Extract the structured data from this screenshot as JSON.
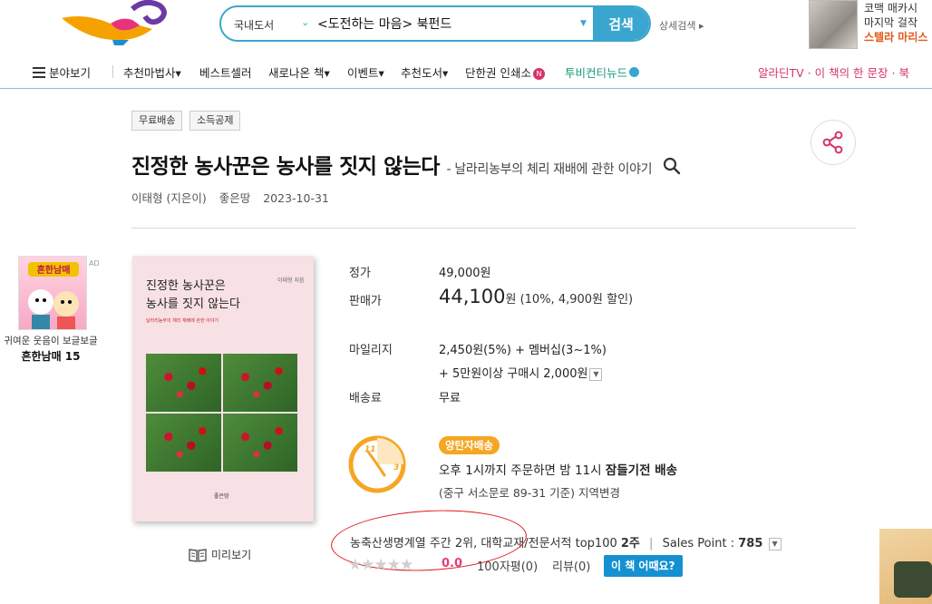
{
  "header": {
    "search": {
      "scope": "국내도서",
      "query": "<도전하는 마음> 북펀드",
      "button_label": "검색",
      "advanced_label": "상세검색 ▸"
    },
    "top_ad": {
      "line1": "코맥 매카시",
      "line2": "마지막 걸작",
      "line3": "스텔라 마리스"
    },
    "nav": {
      "category_label": "분야보기",
      "items": [
        "추천마법사▾",
        "베스트셀러",
        "새로나온 책▾",
        "이벤트▾",
        "추천도서▾",
        "단한권 인쇄소",
        "투비컨티뉴드"
      ],
      "right_label": "알라딘TV · 이 책의 한 문장 · 북"
    }
  },
  "book": {
    "tags": [
      "무료배송",
      "소득공제"
    ],
    "title": "진정한 농사꾼은 농사를 짓지 않는다",
    "subtitle": "- 날라리농부의 체리 재배에 관한 이야기",
    "author": "이태형 (지은이)",
    "publisher": "좋은땅",
    "date": "2023-10-31",
    "cover": {
      "title_line1": "진정한 농사꾼은",
      "title_line2": "농사를 짓지 않는다",
      "author": "이태형 지음",
      "subtitle": "날라리농부의 체리 재배에 관한 이야기",
      "publisher": "좋은땅"
    },
    "preview_label": "미리보기"
  },
  "price": {
    "list_label": "정가",
    "list_value": "49,000원",
    "sale_label": "판매가",
    "sale_value": "44,100",
    "sale_unit": "원",
    "sale_extra": "(10%, 4,900원 할인)",
    "mileage_label": "마일리지",
    "mileage_value": "2,450원(5%) + 멤버십(3~1%)",
    "mileage_extra": "+ 5만원이상 구매시 2,000원",
    "shipping_label": "배송료",
    "shipping_value": "무료"
  },
  "delivery": {
    "badge": "양탄자배송",
    "line1_prefix": "오후 1시까지 주문하면 밤 11시 ",
    "line1_bold": "잠들기전 배송",
    "line2": "(중구 서소문로 89-31 기준) 지역변경",
    "clock_num_11": "11",
    "clock_num_3": "3"
  },
  "ranking": {
    "cat1": "농축산생명계열 주간 2위,",
    "cat2": "대학교재/전문서적 top100",
    "cat2_bold": "2주",
    "sales_label": "Sales Point :",
    "sales_value": "785"
  },
  "rating": {
    "stars": "★★★★★",
    "score": "0.0",
    "count100": "100자평(0)",
    "reviews": "리뷰(0)",
    "ask_label": "이 책 어때요?"
  },
  "side_ad": {
    "badge": "AD",
    "line1": "귀여운 웃음이 보글보글",
    "line2": "흔한남매 15"
  }
}
